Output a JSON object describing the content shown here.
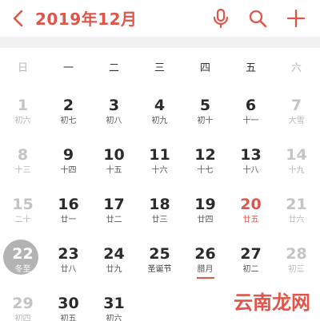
{
  "header": {
    "title": "2019年12月"
  },
  "weekdays": [
    "日",
    "一",
    "二",
    "三",
    "四",
    "五",
    "六"
  ],
  "rows": [
    [
      {
        "d": "1",
        "l": "初六"
      },
      {
        "d": "2",
        "l": "初七"
      },
      {
        "d": "3",
        "l": "初八"
      },
      {
        "d": "4",
        "l": "初九"
      },
      {
        "d": "5",
        "l": "初十"
      },
      {
        "d": "6",
        "l": "十一"
      },
      {
        "d": "7",
        "l": "大雪"
      }
    ],
    [
      {
        "d": "8",
        "l": "十三"
      },
      {
        "d": "9",
        "l": "十四"
      },
      {
        "d": "10",
        "l": "十五"
      },
      {
        "d": "11",
        "l": "十六"
      },
      {
        "d": "12",
        "l": "十七"
      },
      {
        "d": "13",
        "l": "十八"
      },
      {
        "d": "14",
        "l": "十九"
      }
    ],
    [
      {
        "d": "15",
        "l": "二十"
      },
      {
        "d": "16",
        "l": "廿一"
      },
      {
        "d": "17",
        "l": "廿二"
      },
      {
        "d": "18",
        "l": "廿三"
      },
      {
        "d": "19",
        "l": "廿四"
      },
      {
        "d": "20",
        "l": "廿五"
      },
      {
        "d": "21",
        "l": "廿六"
      }
    ],
    [
      {
        "d": "22",
        "l": "冬至"
      },
      {
        "d": "23",
        "l": "廿八"
      },
      {
        "d": "24",
        "l": "廿九"
      },
      {
        "d": "25",
        "l": "圣诞节"
      },
      {
        "d": "26",
        "l": "腊月"
      },
      {
        "d": "27",
        "l": "初二"
      },
      {
        "d": "28",
        "l": "初三"
      }
    ],
    [
      {
        "d": "29",
        "l": "初四"
      },
      {
        "d": "30",
        "l": "初五"
      },
      {
        "d": "31",
        "l": "初六"
      }
    ]
  ],
  "selected_day": "22",
  "holiday_day": "20",
  "festival_day": "25",
  "month_start_day": "26",
  "watermark": "云南龙网",
  "colors": {
    "accent": "#e0554a",
    "weekend": "#c4c4c4",
    "selected_bg": "#b3b3b3"
  }
}
